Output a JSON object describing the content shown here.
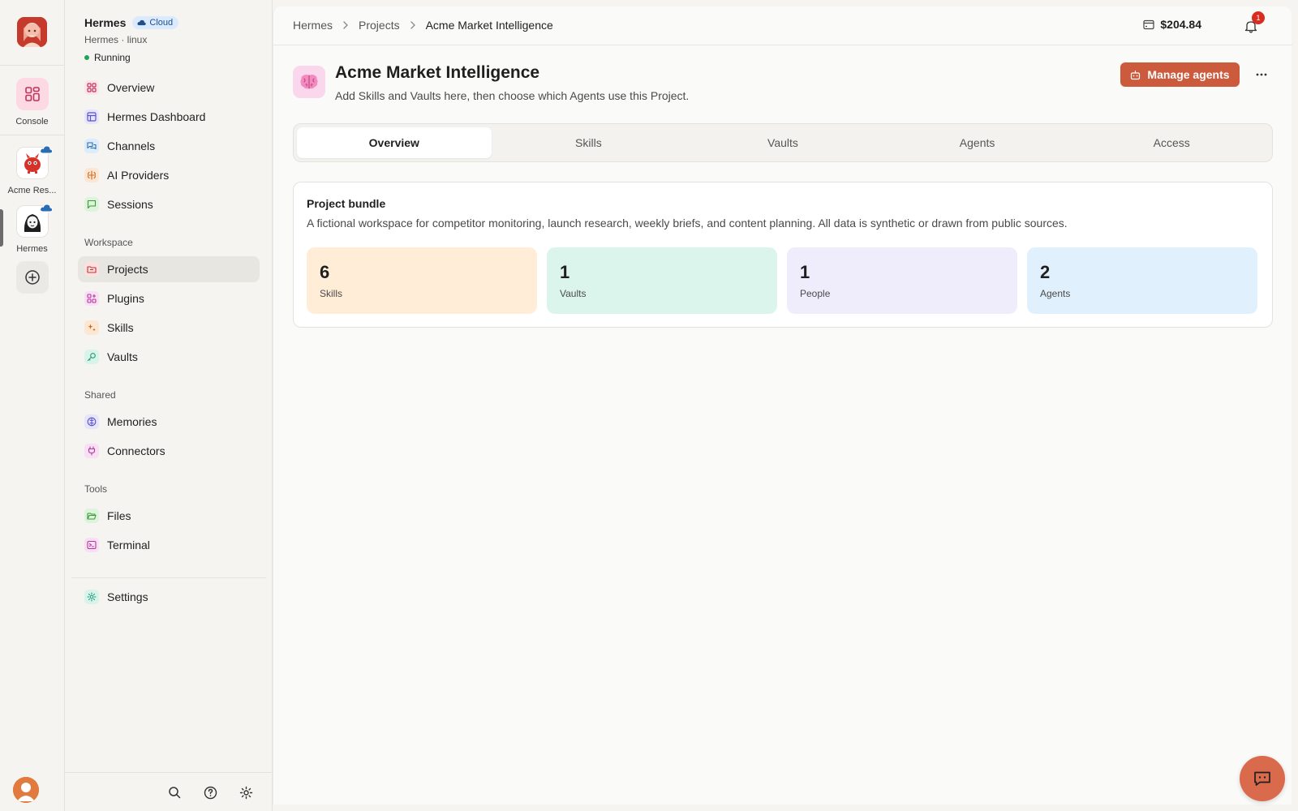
{
  "rail": {
    "items": [
      {
        "label": "Console"
      },
      {
        "label": "Acme Res..."
      },
      {
        "label": "Hermes"
      }
    ]
  },
  "sidebar": {
    "title": "Hermes",
    "badge": "Cloud",
    "subtitle": "Hermes · linux",
    "status": "Running",
    "primary": [
      {
        "label": "Overview"
      },
      {
        "label": "Hermes Dashboard"
      },
      {
        "label": "Channels"
      },
      {
        "label": "AI Providers"
      },
      {
        "label": "Sessions"
      }
    ],
    "sections": {
      "workspace": "Workspace",
      "shared": "Shared",
      "tools": "Tools"
    },
    "workspace": [
      {
        "label": "Projects"
      },
      {
        "label": "Plugins"
      },
      {
        "label": "Skills"
      },
      {
        "label": "Vaults"
      }
    ],
    "shared": [
      {
        "label": "Memories"
      },
      {
        "label": "Connectors"
      }
    ],
    "tools": [
      {
        "label": "Files"
      },
      {
        "label": "Terminal"
      }
    ],
    "settings": "Settings"
  },
  "topbar": {
    "breadcrumb": [
      "Hermes",
      "Projects",
      "Acme Market Intelligence"
    ],
    "balance": "$204.84",
    "notifications": "1"
  },
  "project": {
    "title": "Acme Market Intelligence",
    "description": "Add Skills and Vaults here, then choose which Agents use this Project.",
    "manage_label": "Manage agents"
  },
  "tabs": [
    {
      "label": "Overview"
    },
    {
      "label": "Skills"
    },
    {
      "label": "Vaults"
    },
    {
      "label": "Agents"
    },
    {
      "label": "Access"
    }
  ],
  "bundle": {
    "title": "Project bundle",
    "description": "A fictional workspace for competitor monitoring, launch research, weekly briefs, and content planning. All data is synthetic or drawn from public sources.",
    "stats": [
      {
        "value": "6",
        "label": "Skills",
        "color": "#ffedd8"
      },
      {
        "value": "1",
        "label": "Vaults",
        "color": "#dcf5ec"
      },
      {
        "value": "1",
        "label": "People",
        "color": "#efedfc"
      },
      {
        "value": "2",
        "label": "Agents",
        "color": "#e1f0fd"
      }
    ]
  },
  "colors": {
    "accent": "#cc5a3c",
    "status_running": "#22a35a",
    "badge": "#d92d20"
  }
}
